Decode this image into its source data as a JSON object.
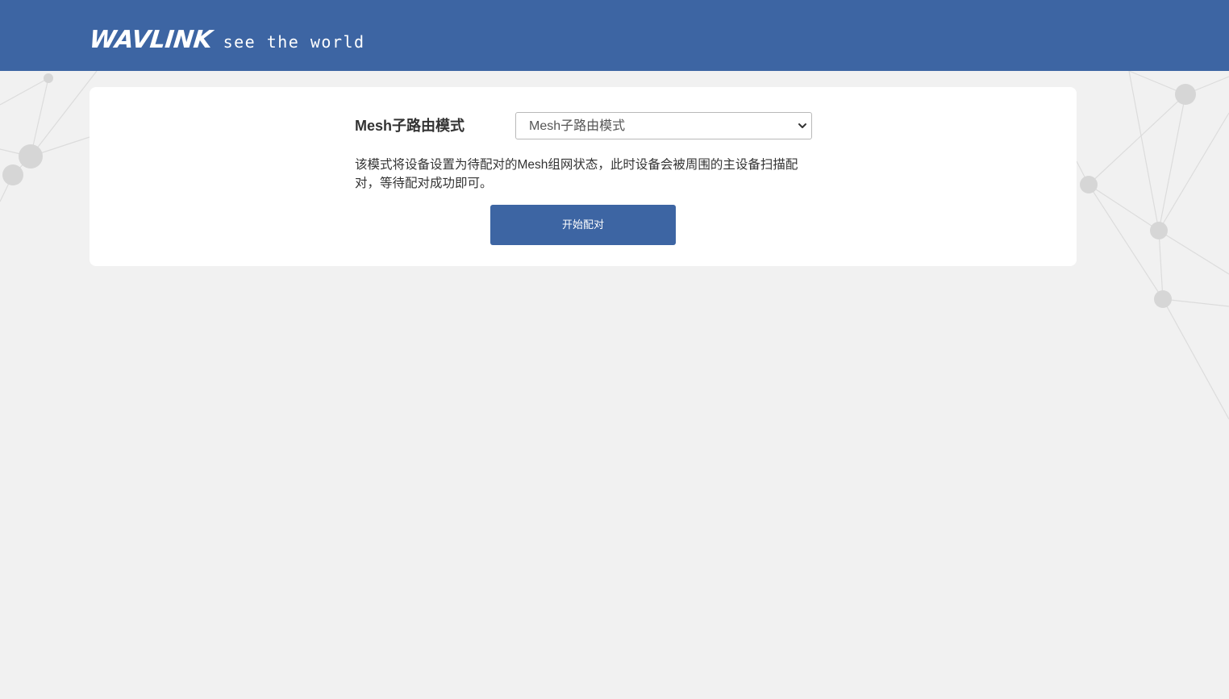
{
  "header": {
    "brand_name": "WAVLINK",
    "tagline": "see the world",
    "background_color": "#3d65a3"
  },
  "mesh_settings": {
    "mode_label": "Mesh子路由模式",
    "mode_select": {
      "selected": "Mesh子路由模式"
    },
    "description": "该模式将设备设置为待配对的Mesh组网状态，此时设备会被周围的主设备扫描配对，等待配对成功即可。",
    "start_pairing_button": "开始配对"
  },
  "colors": {
    "accent": "#3d65a3",
    "page_background": "#f1f1f1",
    "card_background": "#ffffff"
  },
  "icons": {
    "select_arrow": "chevron-down-icon"
  }
}
